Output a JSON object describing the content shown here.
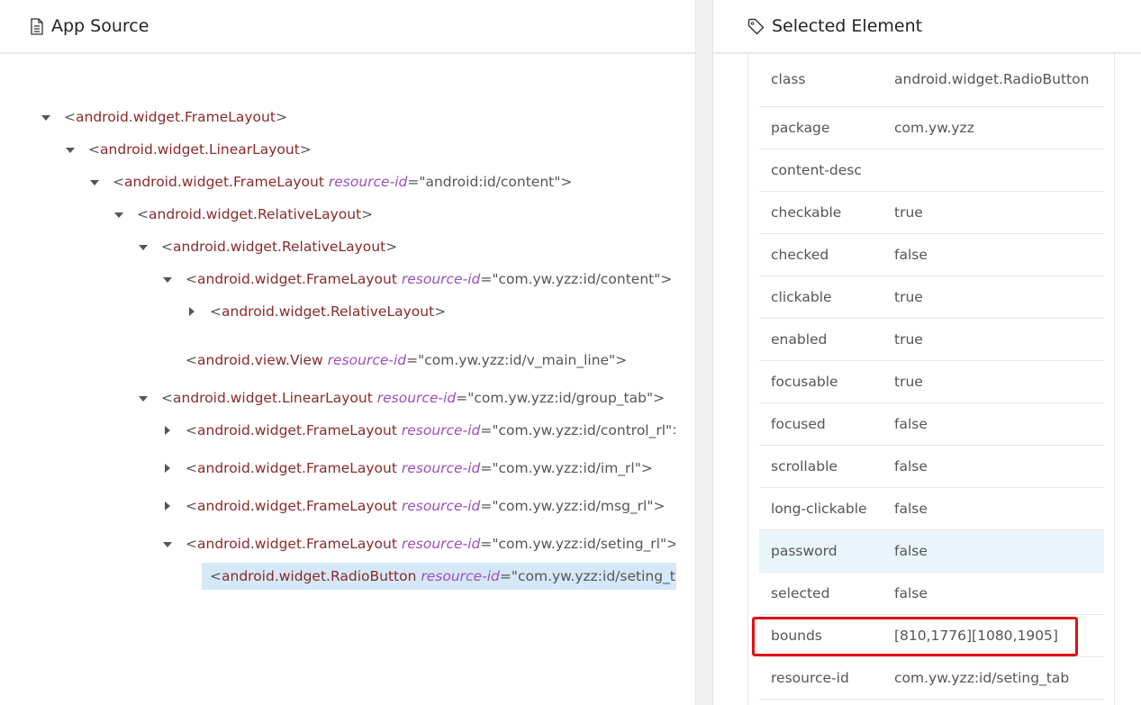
{
  "app_source": {
    "title": "App Source",
    "icon": "file-text-icon",
    "nodes": [
      {
        "level": 0,
        "caret": "down",
        "tag": "android.widget.FrameLayout"
      },
      {
        "level": 1,
        "caret": "down",
        "tag": "android.widget.LinearLayout"
      },
      {
        "level": 2,
        "caret": "down",
        "tag": "android.widget.FrameLayout",
        "attr": "resource-id",
        "value": "android:id/content"
      },
      {
        "level": 3,
        "caret": "down",
        "tag": "android.widget.RelativeLayout"
      },
      {
        "level": 4,
        "caret": "down",
        "tag": "android.widget.RelativeLayout"
      },
      {
        "level": 5,
        "caret": "down",
        "tag": "android.widget.FrameLayout",
        "attr": "resource-id",
        "value": "com.yw.yzz:id/content"
      },
      {
        "level": 6,
        "caret": "right",
        "tag": "android.widget.RelativeLayout"
      },
      {
        "level": 5,
        "caret": "none",
        "tag": "android.view.View",
        "attr": "resource-id",
        "value": "com.yw.yzz:id/v_main_line"
      },
      {
        "level": 4,
        "caret": "down",
        "tag": "android.widget.LinearLayout",
        "attr": "resource-id",
        "value": "com.yw.yzz:id/group_tab"
      },
      {
        "level": 5,
        "caret": "right",
        "tag": "android.widget.FrameLayout",
        "attr": "resource-id",
        "value": "com.yw.yzz:id/control_rl"
      },
      {
        "level": 5,
        "caret": "right",
        "tag": "android.widget.FrameLayout",
        "attr": "resource-id",
        "value": "com.yw.yzz:id/im_rl"
      },
      {
        "level": 5,
        "caret": "right",
        "tag": "android.widget.FrameLayout",
        "attr": "resource-id",
        "value": "com.yw.yzz:id/msg_rl"
      },
      {
        "level": 5,
        "caret": "down",
        "tag": "android.widget.FrameLayout",
        "attr": "resource-id",
        "value": "com.yw.yzz:id/seting_rl"
      },
      {
        "level": 6,
        "caret": "none",
        "tag": "android.widget.RadioButton",
        "attr": "resource-id",
        "value": "com.yw.yzz:id/seting_t",
        "selected": true
      }
    ]
  },
  "selected_element": {
    "title": "Selected Element",
    "icon": "tag-icon",
    "attributes": [
      {
        "name": "class",
        "value": "android.widget.RadioButton"
      },
      {
        "name": "package",
        "value": "com.yw.yzz"
      },
      {
        "name": "content-desc",
        "value": ""
      },
      {
        "name": "checkable",
        "value": "true"
      },
      {
        "name": "checked",
        "value": "false"
      },
      {
        "name": "clickable",
        "value": "true"
      },
      {
        "name": "enabled",
        "value": "true"
      },
      {
        "name": "focusable",
        "value": "true"
      },
      {
        "name": "focused",
        "value": "false"
      },
      {
        "name": "scrollable",
        "value": "false"
      },
      {
        "name": "long-clickable",
        "value": "false"
      },
      {
        "name": "password",
        "value": "false"
      },
      {
        "name": "selected",
        "value": "false"
      },
      {
        "name": "bounds",
        "value": "[810,1776][1080,1905]"
      },
      {
        "name": "resource-id",
        "value": "com.yw.yzz:id/seting_tab"
      }
    ],
    "hovered_row": "password",
    "highlighted_row": "bounds",
    "highlight_color": "#e01010"
  }
}
